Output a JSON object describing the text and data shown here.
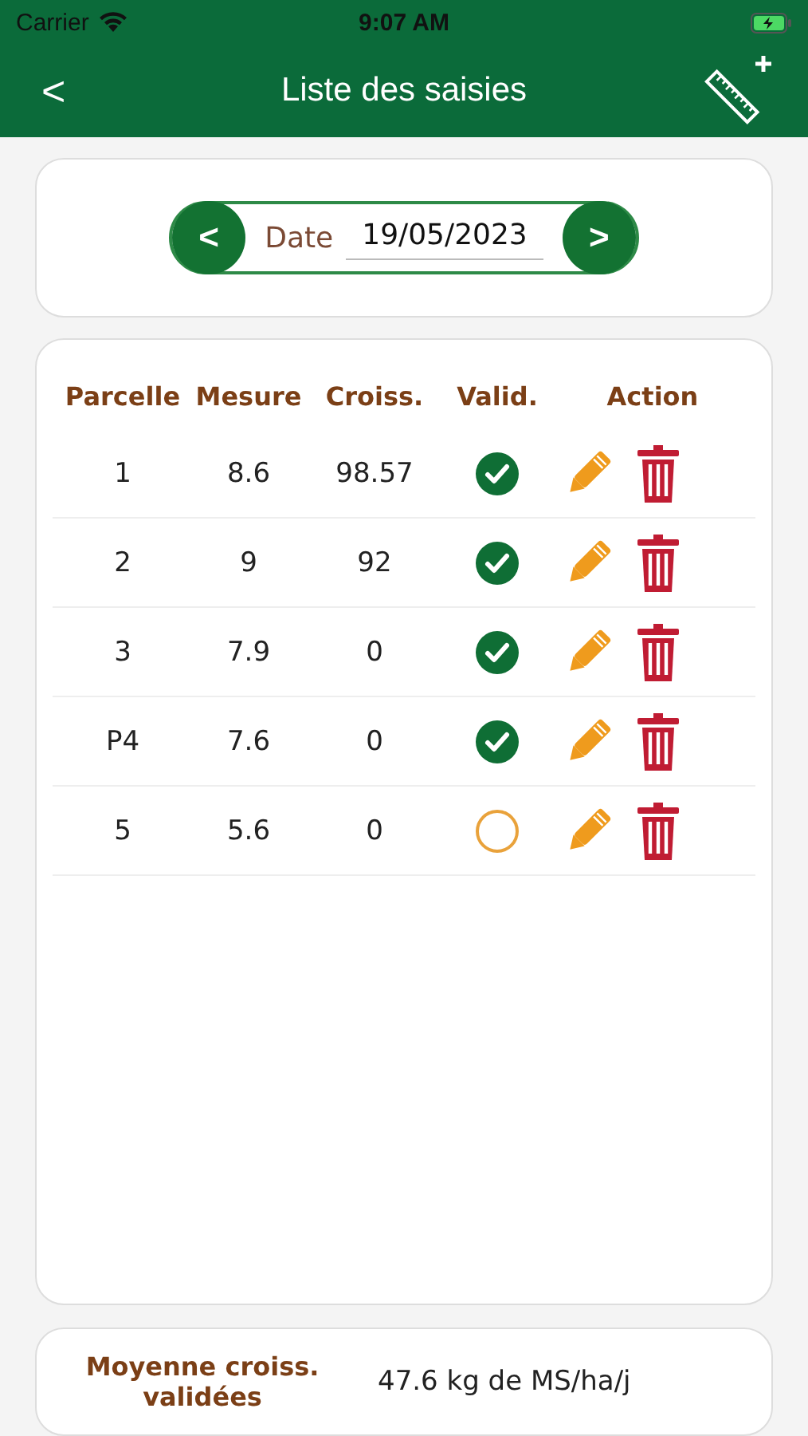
{
  "status_bar": {
    "carrier": "Carrier",
    "time": "9:07 AM"
  },
  "nav": {
    "back": "<",
    "title": "Liste des saisies"
  },
  "date_picker": {
    "prev": "<",
    "label": "Date",
    "value": "19/05/2023",
    "next": ">"
  },
  "table": {
    "columns": [
      "Parcelle",
      "Mesure",
      "Croiss.",
      "Valid.",
      "Action"
    ],
    "rows": [
      {
        "parcelle": "1",
        "mesure": "8.6",
        "croiss": "98.57",
        "validated": true
      },
      {
        "parcelle": "2",
        "mesure": "9",
        "croiss": "92",
        "validated": true
      },
      {
        "parcelle": "3",
        "mesure": "7.9",
        "croiss": "0",
        "validated": true
      },
      {
        "parcelle": "P4",
        "mesure": "7.6",
        "croiss": "0",
        "validated": true
      },
      {
        "parcelle": "5",
        "mesure": "5.6",
        "croiss": "0",
        "validated": false
      }
    ]
  },
  "summary": {
    "label": "Moyenne croiss. validées",
    "value": "47.6 kg de MS/ha/j"
  }
}
